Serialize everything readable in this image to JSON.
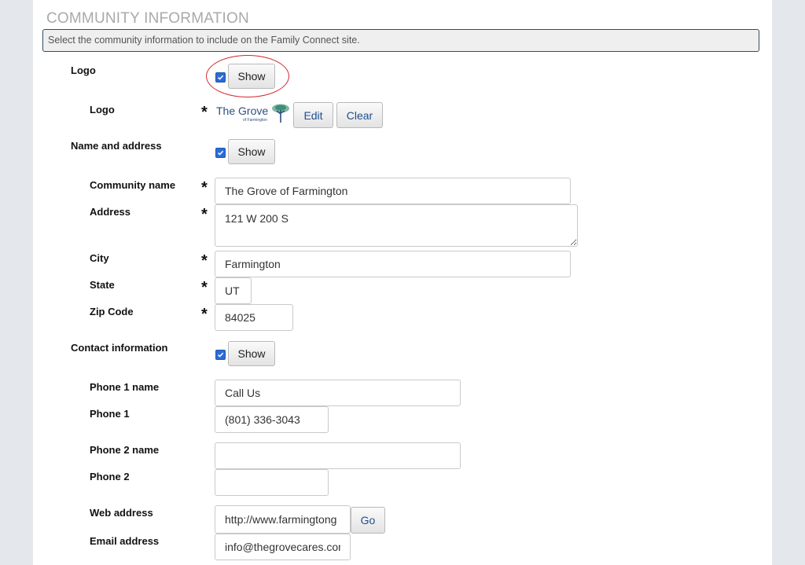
{
  "section": {
    "title": "COMMUNITY INFORMATION",
    "description": "Select the community information to include on the Family Connect site."
  },
  "logo_group": {
    "label": "Logo",
    "show_checked": true,
    "show_label": "Show"
  },
  "logo_field": {
    "label": "Logo",
    "image_text": "The Grove",
    "image_subtext": "of Farmington",
    "edit_label": "Edit",
    "clear_label": "Clear"
  },
  "name_address_group": {
    "label": "Name and address",
    "show_checked": true,
    "show_label": "Show"
  },
  "community_name": {
    "label": "Community name",
    "value": "The Grove of Farmington"
  },
  "address": {
    "label": "Address",
    "value": "121 W 200 S"
  },
  "city": {
    "label": "City",
    "value": "Farmington"
  },
  "state": {
    "label": "State",
    "value": "UT"
  },
  "zip": {
    "label": "Zip Code",
    "value": "84025"
  },
  "contact_group": {
    "label": "Contact information",
    "show_checked": true,
    "show_label": "Show"
  },
  "phone1_name": {
    "label": "Phone 1 name",
    "value": "Call Us"
  },
  "phone1": {
    "label": "Phone 1",
    "value": "(801) 336-3043"
  },
  "phone2_name": {
    "label": "Phone 2 name",
    "value": ""
  },
  "phone2": {
    "label": "Phone 2",
    "value": ""
  },
  "web": {
    "label": "Web address",
    "value": "http://www.farmingtong",
    "go_label": "Go"
  },
  "email": {
    "label": "Email address",
    "value": "info@thegrovecares.con"
  },
  "required_marker": "*",
  "colors": {
    "panel_bg": "#ffffff",
    "page_bg": "#e4e8ec",
    "accent": "#2a6bd6",
    "highlight": "#d2262a",
    "title": "#a9a9a9"
  }
}
